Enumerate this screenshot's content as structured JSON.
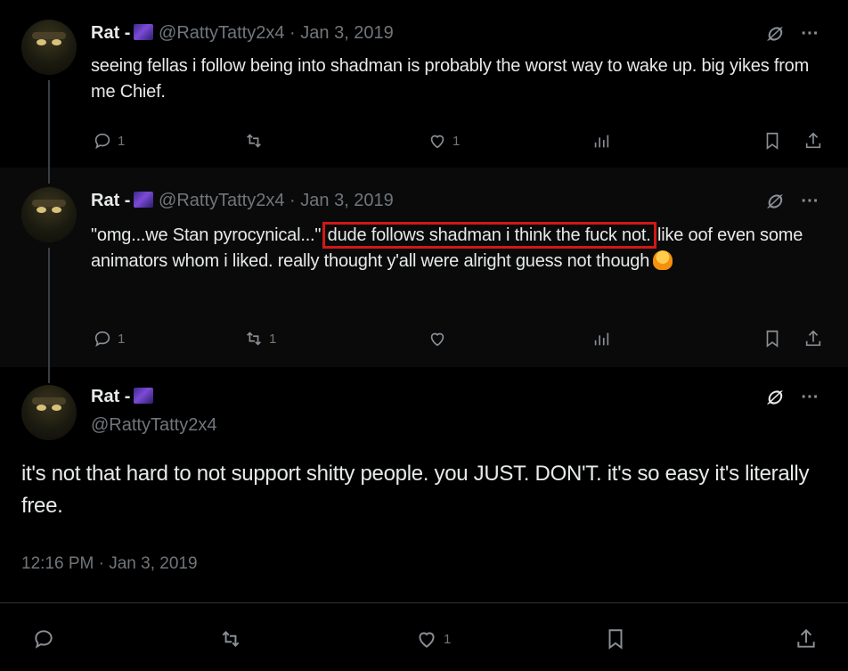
{
  "tweets": [
    {
      "name": "Rat -",
      "handle": "@RattyTatty2x4",
      "date": "· Jan 3, 2019",
      "text": "seeing fellas i follow being into shadman is probably the worst way to wake up. big yikes from me Chief.",
      "stats": {
        "replies": "1",
        "retweets": "",
        "likes": "1"
      }
    },
    {
      "name": "Rat -",
      "handle": "@RattyTatty2x4",
      "date": "· Jan 3, 2019",
      "text_before": "\"omg...we Stan pyrocynical...\" ",
      "text_highlight": "dude follows shadman i think the fuck not.",
      "text_after": " like oof even some animators whom i liked. really thought y'all were alright guess not though",
      "stats": {
        "replies": "1",
        "retweets": "1",
        "likes": ""
      }
    }
  ],
  "main_tweet": {
    "name": "Rat -",
    "handle": "@RattyTatty2x4",
    "text": "it's not that hard to not support shitty people. you JUST. DON'T. it's so easy it's literally free.",
    "timestamp": "12:16 PM · Jan 3, 2019",
    "stats": {
      "replies": "",
      "retweets": "",
      "likes": "1"
    }
  },
  "icons": {
    "more": "···",
    "edited": "∅"
  },
  "colors": {
    "highlight_box": "#d01818",
    "muted": "#71767b"
  }
}
